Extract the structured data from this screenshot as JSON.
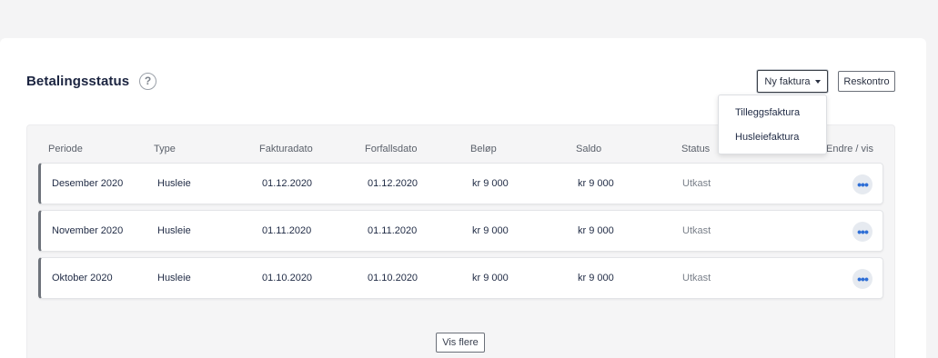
{
  "header": {
    "title": "Betalingsstatus",
    "help_icon": "question-circle-icon",
    "new_invoice_label": "Ny faktura",
    "ledger_label": "Reskontro"
  },
  "dropdown": {
    "items": [
      {
        "label": "Tilleggsfaktura"
      },
      {
        "label": "Husleiefaktura"
      }
    ]
  },
  "table": {
    "columns": [
      "Periode",
      "Type",
      "Fakturadato",
      "Forfallsdato",
      "Beløp",
      "Saldo",
      "Status",
      "Endre / vis"
    ],
    "rows": [
      {
        "periode": "Desember 2020",
        "type": "Husleie",
        "fakturadato": "01.12.2020",
        "forfallsdato": "01.12.2020",
        "belop": "kr 9 000",
        "saldo": "kr 9 000",
        "status": "Utkast",
        "action": "•••"
      },
      {
        "periode": "November 2020",
        "type": "Husleie",
        "fakturadato": "01.11.2020",
        "forfallsdato": "01.11.2020",
        "belop": "kr 9 000",
        "saldo": "kr 9 000",
        "status": "Utkast",
        "action": "•••"
      },
      {
        "periode": "Oktober 2020",
        "type": "Husleie",
        "fakturadato": "01.10.2020",
        "forfallsdato": "01.10.2020",
        "belop": "kr 9 000",
        "saldo": "kr 9 000",
        "status": "Utkast",
        "action": "•••"
      }
    ]
  },
  "footer": {
    "show_more_label": "Vis flere"
  },
  "colors": {
    "accent": "#2f6fd6",
    "row_border_left": "#6e737b",
    "page_bg": "#f4f4f5"
  }
}
